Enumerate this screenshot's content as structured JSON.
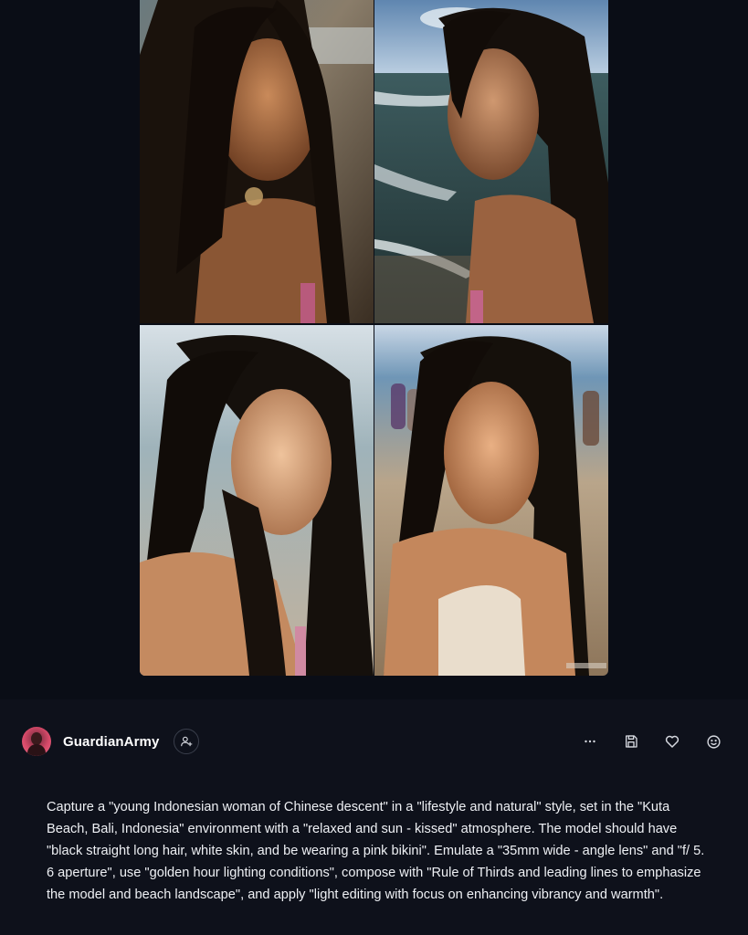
{
  "author": {
    "username": "GuardianArmy"
  },
  "icons": {
    "follow": "user-plus-icon",
    "more": "more-horizontal-icon",
    "save": "save-icon",
    "like": "heart-icon",
    "react": "smile-icon"
  },
  "prompt": {
    "text": "Capture a \"young Indonesian woman of Chinese descent\" in a \"lifestyle and natural\" style, set in the \"Kuta Beach, Bali, Indonesia\" environment with a \"relaxed and sun - kissed\" atmosphere. The model should have \"black straight long hair, white skin, and be wearing a pink bikini\". Emulate a \"35mm wide - angle lens\" and \"f/ 5. 6 aperture\", use \"golden hour lighting conditions\", compose with \"Rule of Thirds and leading lines to emphasize the model and beach landscape\", and apply \"light editing with focus on enhancing vibrancy and warmth\"."
  },
  "colors": {
    "background": "#0d1019",
    "text": "#eef0f4",
    "icon": "#d6d9e0"
  }
}
